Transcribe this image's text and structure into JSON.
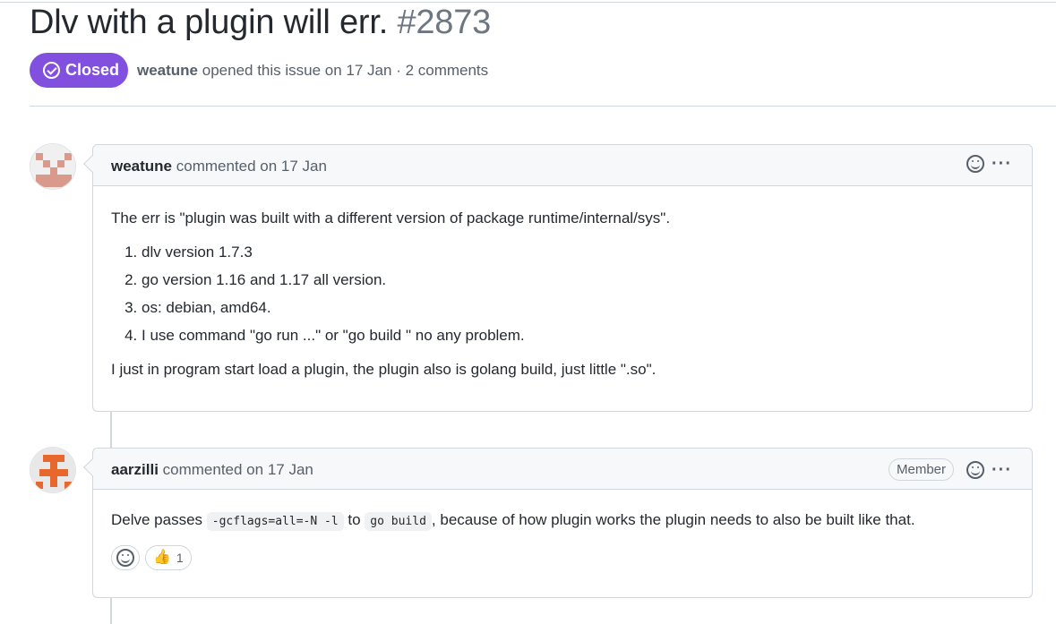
{
  "issue": {
    "title": "Dlv with a plugin will err.",
    "number": "#2873",
    "state": "Closed",
    "state_color": "#8250df",
    "author": "weatune",
    "meta_rest": " opened this issue on 17 Jan · 2 comments"
  },
  "comments": [
    {
      "author": "weatune",
      "action": " commented on 17 Jan",
      "body_intro": "The err is \"plugin was built with a different version of package runtime/internal/sys\".",
      "list": [
        "dlv version 1.7.3",
        "go version 1.16 and 1.17 all version.",
        "os: debian, amd64.",
        "I use command \"go run ...\" or \"go build \" no any problem."
      ],
      "body_outro": "I just in program start load a plugin, the plugin also is golang build, just little \".so\"."
    },
    {
      "author": "aarzilli",
      "action": " commented on 17 Jan",
      "badge": "Member",
      "text_1": "Delve passes ",
      "code_1": "-gcflags=all=-N -l",
      "text_2": " to ",
      "code_2": "go build",
      "text_3": ", because of how plugin works the plugin needs to also be built like that.",
      "thumbs_up_count": "1"
    }
  ],
  "icons": {
    "state": "circle-check-icon",
    "add_reaction": "smiley-icon",
    "more": "kebab-horizontal-icon",
    "thumbs_up": "thumbs-up-icon"
  }
}
